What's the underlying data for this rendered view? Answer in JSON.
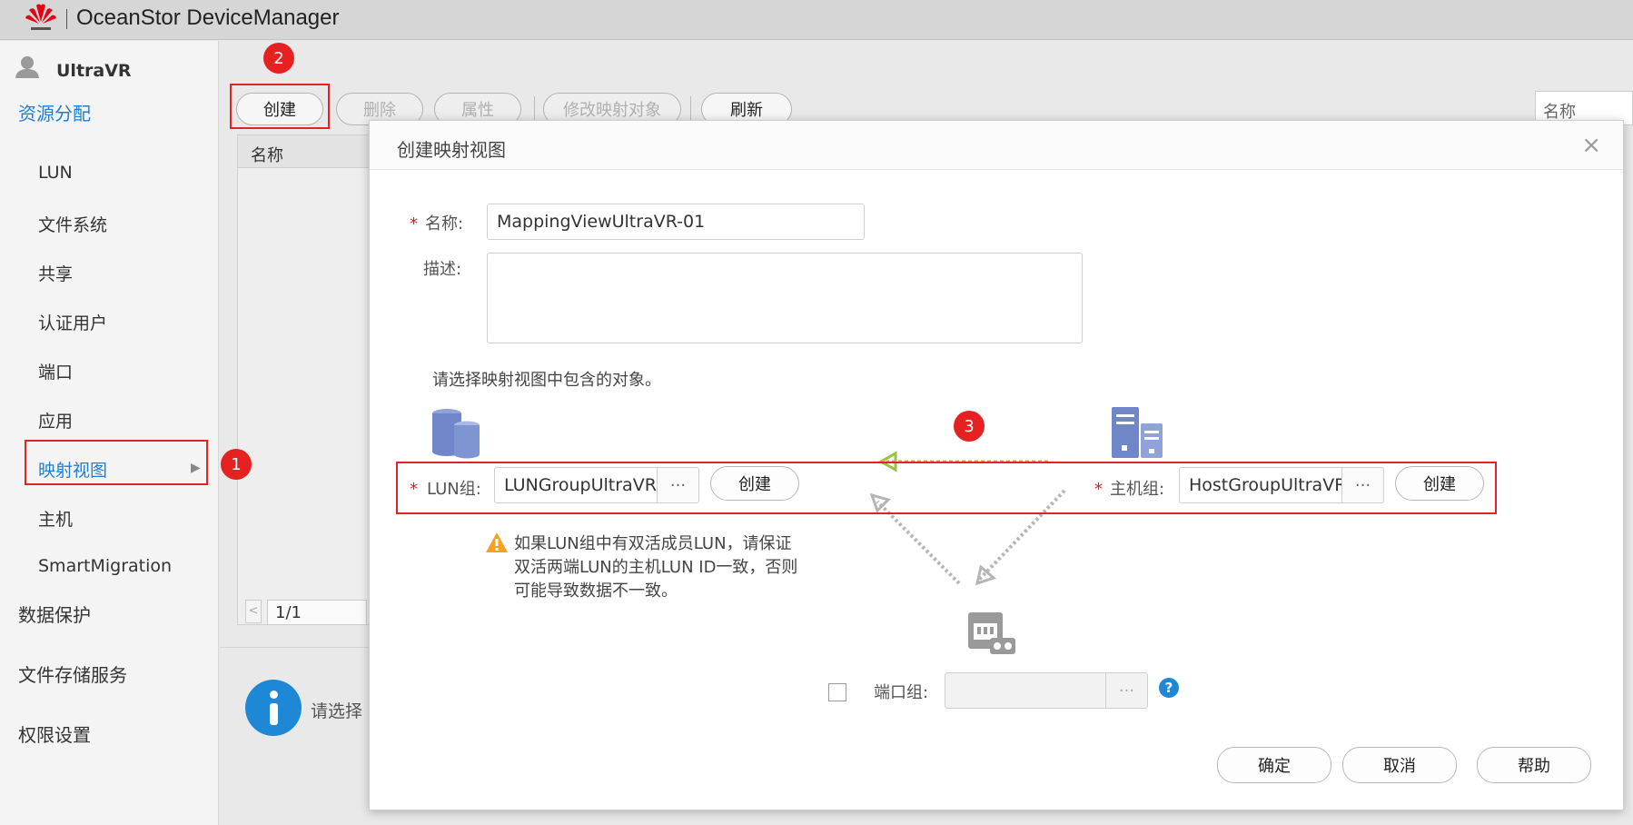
{
  "app": {
    "title": "OceanStor DeviceManager"
  },
  "user": {
    "name": "UltraVR"
  },
  "sidebar": {
    "top": "资源分配",
    "items": [
      "LUN",
      "文件系统",
      "共享",
      "认证用户",
      "端口",
      "应用",
      "映射视图",
      "主机",
      "SmartMigration"
    ],
    "sections": [
      "数据保护",
      "文件存储服务",
      "权限设置"
    ]
  },
  "toolbar": {
    "create": "创建",
    "delete": "删除",
    "properties": "属性",
    "modify": "修改映射对象",
    "refresh": "刷新",
    "search_placeholder": "名称"
  },
  "table": {
    "column_name": "名称",
    "page": "1/1"
  },
  "info": {
    "text": "请选择"
  },
  "annotations": {
    "b1": "1",
    "b2": "2",
    "b3": "3"
  },
  "dialog": {
    "title": "创建映射视图",
    "close": "×",
    "name_label": "名称:",
    "name_value": "MappingViewUltraVR-01",
    "desc_label": "描述:",
    "hint": "请选择映射视图中包含的对象。",
    "lun_label": "LUN组:",
    "lun_value": "LUNGroupUltraVR",
    "host_label": "主机组:",
    "host_value": "HostGroupUltraVR",
    "dots": "···",
    "create": "创建",
    "warning": "如果LUN组中有双活成员LUN，请保证双活两端LUN的主机LUN ID一致，否则可能导致数据不一致。",
    "port_label": "端口组:",
    "help_icon_text": "?",
    "ok": "确定",
    "cancel": "取消",
    "help": "帮助"
  },
  "colors": {
    "accent": "#1e7fd2",
    "annotation": "#e52121",
    "arrow": "#8cc63f"
  }
}
